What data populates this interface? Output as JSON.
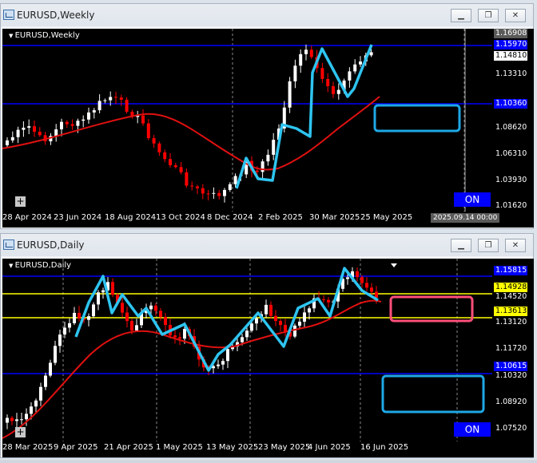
{
  "windows": [
    {
      "title": "EURUSD,Weekly",
      "symbol_label": "EURUSD,Weekly",
      "controls": [
        "minimize",
        "restore",
        "close"
      ],
      "y_labels": [
        "1.16908",
        "1.14810",
        "1.13310",
        "1.08620",
        "1.06310",
        "1.03930",
        "1.01620"
      ],
      "tags": [
        {
          "text": "1.15970",
          "color": "#0000ff"
        },
        {
          "text": "1.16908",
          "color": "#5a5a5a"
        },
        {
          "text": "1.14810",
          "color": "#ffffff"
        },
        {
          "text": "1.10360",
          "color": "#0000ff"
        }
      ],
      "x_labels": [
        "28 Apr 2024",
        "23 Jun 2024",
        "18 Aug 2024",
        "13 Oct 2024",
        "8 Dec 2024",
        "2 Feb 2025",
        "30 Mar 2025",
        "25 May 2025"
      ],
      "crosshair_date": "2025.09.14 00:00",
      "on_button": "ON",
      "chart_data": {
        "type": "candlestick",
        "timeframe": "Weekly",
        "ylim": [
          1.01,
          1.175
        ],
        "horizontal_lines": [
          1.1597,
          1.1036
        ],
        "moving_average": "red",
        "zigzag": "cyan",
        "highlight_box": {
          "color": "#1ea8e6"
        }
      }
    },
    {
      "title": "EURUSD,Daily",
      "symbol_label": "EURUSD,Daily",
      "controls": [
        "minimize",
        "restore",
        "close"
      ],
      "y_labels": [
        "1.14520",
        "1.13120",
        "1.11720",
        "1.10320",
        "1.08920",
        "1.07520"
      ],
      "tags": [
        {
          "text": "1.15815",
          "color": "#0000ff"
        },
        {
          "text": "1.14928",
          "color": "#ffff00"
        },
        {
          "text": "1.13613",
          "color": "#ffff00"
        },
        {
          "text": "1.10615",
          "color": "#0000ff"
        }
      ],
      "x_labels": [
        "28 Mar 2025",
        "9 Apr 2025",
        "21 Apr 2025",
        "1 May 2025",
        "13 May 2025",
        "23 May 2025",
        "4 Jun 2025",
        "16 Jun 2025"
      ],
      "on_button": "ON",
      "chart_data": {
        "type": "candlestick",
        "timeframe": "Daily",
        "ylim": [
          1.073,
          1.163
        ],
        "horizontal_lines": [
          1.15815,
          1.14928,
          1.13613,
          1.10615
        ],
        "moving_average": "red",
        "zigzag": "cyan",
        "highlight_boxes": [
          {
            "color": "#ff4f7a"
          },
          {
            "color": "#1ea8e6"
          }
        ]
      }
    }
  ]
}
